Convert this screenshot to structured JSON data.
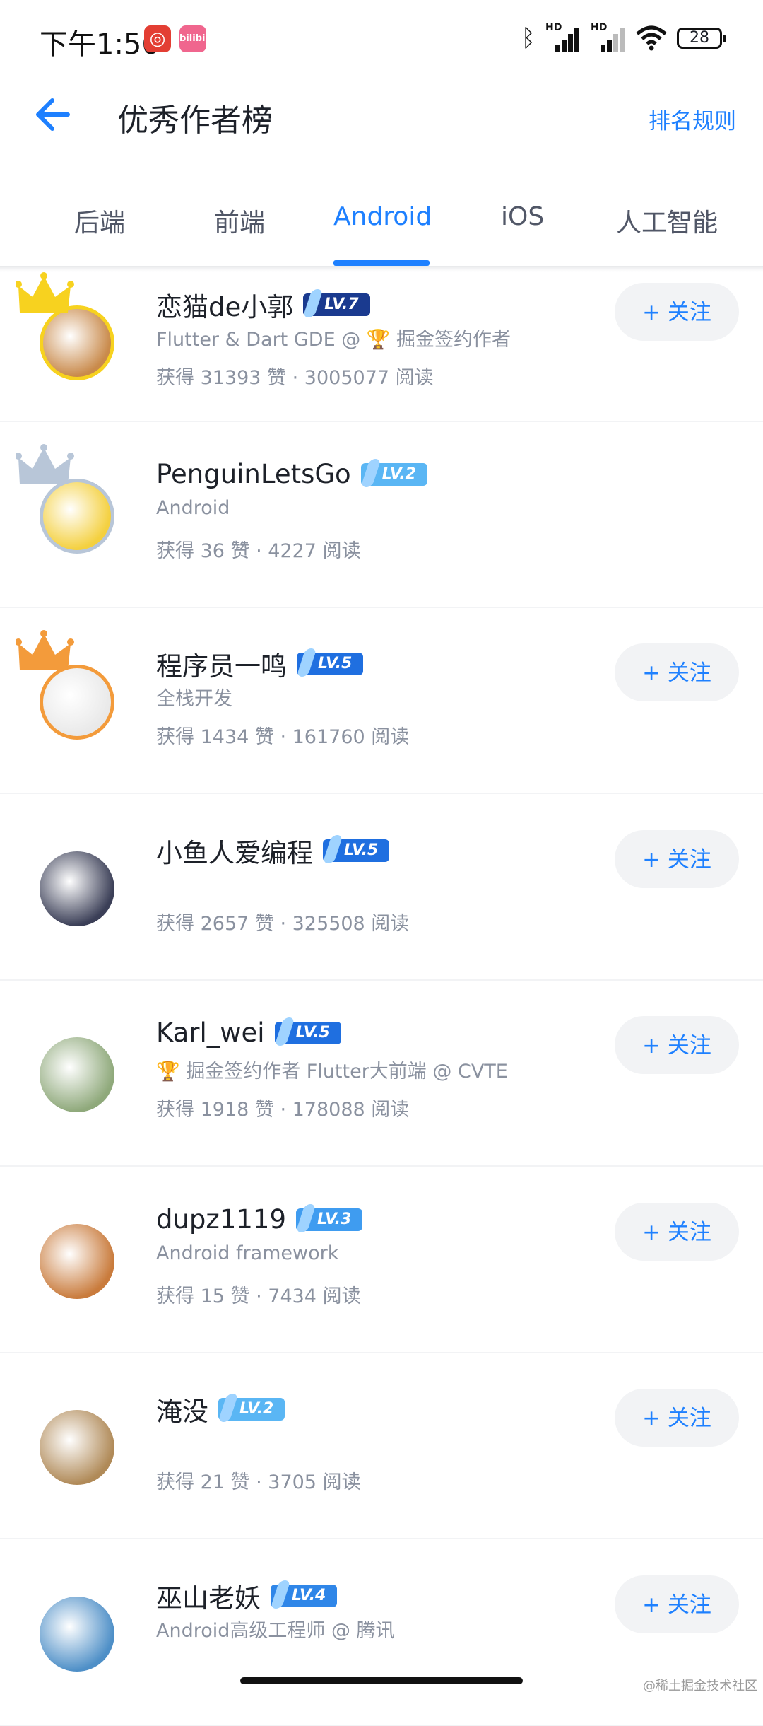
{
  "status_bar": {
    "time": "下午1:56",
    "battery": "28",
    "icons": [
      "netease-music-icon",
      "bilibili-icon",
      "bluetooth-icon",
      "hd-signal-icon",
      "hd-signal-icon",
      "wifi-icon",
      "battery-icon"
    ],
    "app_label_2": "bilibili",
    "hd": "HD"
  },
  "header": {
    "title": "优秀作者榜",
    "rules": "排名规则"
  },
  "tabs": [
    {
      "label": "后端"
    },
    {
      "label": "前端"
    },
    {
      "label": "Android",
      "active": true
    },
    {
      "label": "iOS"
    },
    {
      "label": "人工智能"
    }
  ],
  "authors": [
    {
      "name": "恋猫de小郭",
      "level": "LV.7",
      "desc": "Flutter & Dart GDE @ 🏆 掘金签约作者",
      "stats": "获得 31393 赞 · 3005077 阅读",
      "follow": "+ 关注",
      "crown": "gold",
      "avatar_color": "#c98a4b"
    },
    {
      "name": "PenguinLetsGo",
      "level": "LV.2",
      "desc": "Android",
      "stats": "获得 36 赞 · 4227 阅读",
      "follow": "",
      "crown": "silver",
      "avatar_color": "#f4d03f"
    },
    {
      "name": "程序员一鸣",
      "level": "LV.5",
      "desc": "全栈开发",
      "stats": "获得 1434 赞 · 161760 阅读",
      "follow": "+ 关注",
      "crown": "bronze",
      "avatar_color": "#e9e9e9"
    },
    {
      "name": "小鱼人爱编程",
      "level": "LV.5",
      "desc": "",
      "stats": "获得 2657 赞 · 325508 阅读",
      "follow": "+ 关注",
      "crown": "",
      "avatar_color": "#3b3f57"
    },
    {
      "name": "Karl_wei",
      "level": "LV.5",
      "desc": "🏆 掘金签约作者 Flutter大前端 @ CVTE",
      "stats": "获得 1918 赞 · 178088 阅读",
      "follow": "+ 关注",
      "crown": "",
      "avatar_color": "#8fa97b"
    },
    {
      "name": "dupz1119",
      "level": "LV.3",
      "desc": "Android framework",
      "stats": "获得 15 赞 · 7434 阅读",
      "follow": "+ 关注",
      "crown": "",
      "avatar_color": "#c97b3c"
    },
    {
      "name": "淹没",
      "level": "LV.2",
      "desc": "",
      "stats": "获得 21 赞 · 3705 阅读",
      "follow": "+ 关注",
      "crown": "",
      "avatar_color": "#b08a58"
    },
    {
      "name": "巫山老妖",
      "level": "LV.4",
      "desc": "Android高级工程师 @ 腾讯",
      "stats": "",
      "follow": "+ 关注",
      "crown": "",
      "avatar_color": "#4e8fc7"
    }
  ],
  "level_colors": {
    "LV.2": "#5ab6f4",
    "LV.3": "#3f9cf0",
    "LV.4": "#2f86e8",
    "LV.5": "#1f6fe0",
    "LV.7": "#1a3a8f"
  },
  "watermark": "@稀土掘金技术社区"
}
